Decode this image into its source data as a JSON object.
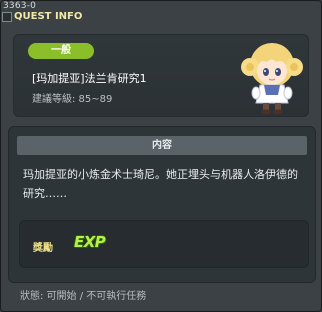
{
  "window": {
    "quest_id": "3363-0",
    "title": "QUEST INFO"
  },
  "header": {
    "category": "一般",
    "quest_name": "[玛加提亚]法兰肯研究1",
    "level_requirement": "建議等級: 85~89"
  },
  "content": {
    "header": "内容",
    "description": "玛加提亚的小炼金术士琦尼。她正埋头与机器人洛伊德的研究……"
  },
  "reward": {
    "label": "獎勵",
    "exp_icon_text": "EXP"
  },
  "status": {
    "text": "狀態: 可開始 / 不可執行任務"
  },
  "colors": {
    "background": "#3b4144",
    "tag_green": "#8bbf2a",
    "title_yellow": "#f2e9a6",
    "exp_green": "#b8f04a"
  }
}
